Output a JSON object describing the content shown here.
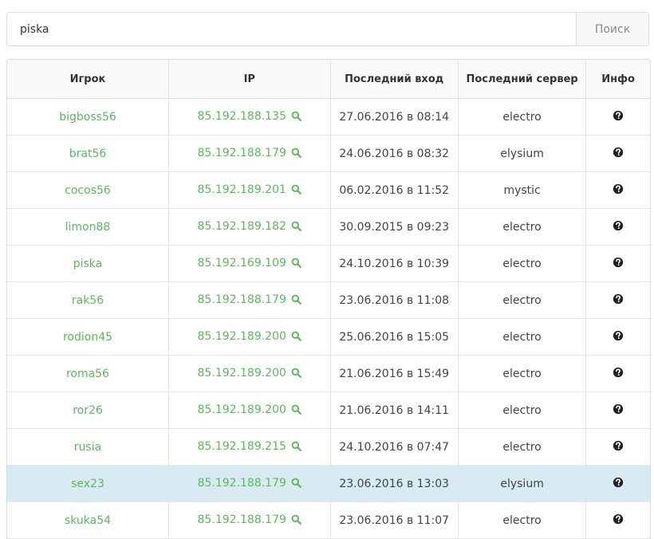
{
  "search": {
    "value": "piska",
    "button_label": "Поиск"
  },
  "colors": {
    "accent_green": "#5cb85c",
    "highlight_row": "#d8ebf3"
  },
  "table": {
    "headers": [
      "Игрок",
      "IP",
      "Последний вход",
      "Последний сервер",
      "Инфо"
    ],
    "highlighted_row": "sex23",
    "rows": [
      {
        "player": "bigboss56",
        "ip": "85.192.188.135",
        "last_login": "27.06.2016 в 08:14",
        "server": "electro"
      },
      {
        "player": "brat56",
        "ip": "85.192.188.179",
        "last_login": "24.06.2016 в 08:32",
        "server": "elysium"
      },
      {
        "player": "cocos56",
        "ip": "85.192.189.201",
        "last_login": "06.02.2016 в 11:52",
        "server": "mystic"
      },
      {
        "player": "limon88",
        "ip": "85.192.189.182",
        "last_login": "30.09.2015 в 09:23",
        "server": "electro"
      },
      {
        "player": "piska",
        "ip": "85.192.169.109",
        "last_login": "24.10.2016 в 10:39",
        "server": "electro"
      },
      {
        "player": "rak56",
        "ip": "85.192.188.179",
        "last_login": "23.06.2016 в 11:08",
        "server": "electro"
      },
      {
        "player": "rodion45",
        "ip": "85.192.189.200",
        "last_login": "25.06.2016 в 15:05",
        "server": "electro"
      },
      {
        "player": "roma56",
        "ip": "85.192.189.200",
        "last_login": "21.06.2016 в 15:49",
        "server": "electro"
      },
      {
        "player": "ror26",
        "ip": "85.192.189.200",
        "last_login": "21.06.2016 в 14:11",
        "server": "electro"
      },
      {
        "player": "rusia",
        "ip": "85.192.189.215",
        "last_login": "24.10.2016 в 07:47",
        "server": "electro"
      },
      {
        "player": "sex23",
        "ip": "85.192.188.179",
        "last_login": "23.06.2016 в 13:03",
        "server": "elysium"
      },
      {
        "player": "skuka54",
        "ip": "85.192.188.179",
        "last_login": "23.06.2016 в 11:07",
        "server": "electro"
      }
    ],
    "icons": {
      "ip_lookup": "search-icon",
      "info": "question-circle-icon"
    }
  }
}
